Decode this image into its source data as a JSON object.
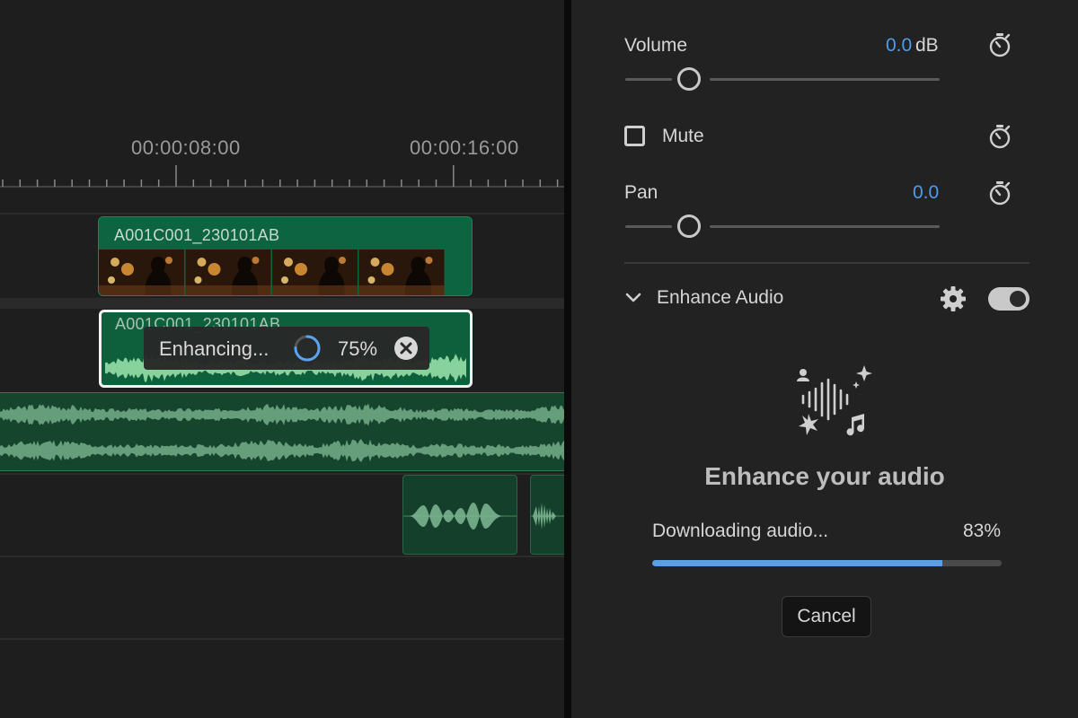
{
  "timeline": {
    "timecodes": [
      "00:00:08:00",
      "00:00:16:00"
    ],
    "video_clip": {
      "name": "A001C001_230101AB"
    },
    "audio_clip": {
      "name": "A001C001_230101AB",
      "status": "Enhancing...",
      "progress_percent": 75,
      "progress_label": "75%"
    }
  },
  "panel": {
    "volume": {
      "label": "Volume",
      "value": "0.0",
      "unit": "dB"
    },
    "mute": {
      "label": "Mute",
      "checked": false
    },
    "pan": {
      "label": "Pan",
      "value": "0.0"
    },
    "enhance": {
      "section_title": "Enhance Audio",
      "enabled": true,
      "heading": "Enhance your audio",
      "download_label": "Downloading audio...",
      "download_percent": 83,
      "download_pct_label": "83%",
      "cancel_label": "Cancel"
    }
  },
  "colors": {
    "accent_blue": "#4b9cf0",
    "clip_green": "#0d6440",
    "waveform_green": "#8fd9a2",
    "progress_fill": "#5b9de6"
  },
  "icons": [
    "stopwatch-icon",
    "checkbox-icon",
    "chevron-down-icon",
    "gear-icon",
    "toggle-switch",
    "spinner-icon",
    "close-circle-icon",
    "enhance-audio-illustration-icon"
  ]
}
